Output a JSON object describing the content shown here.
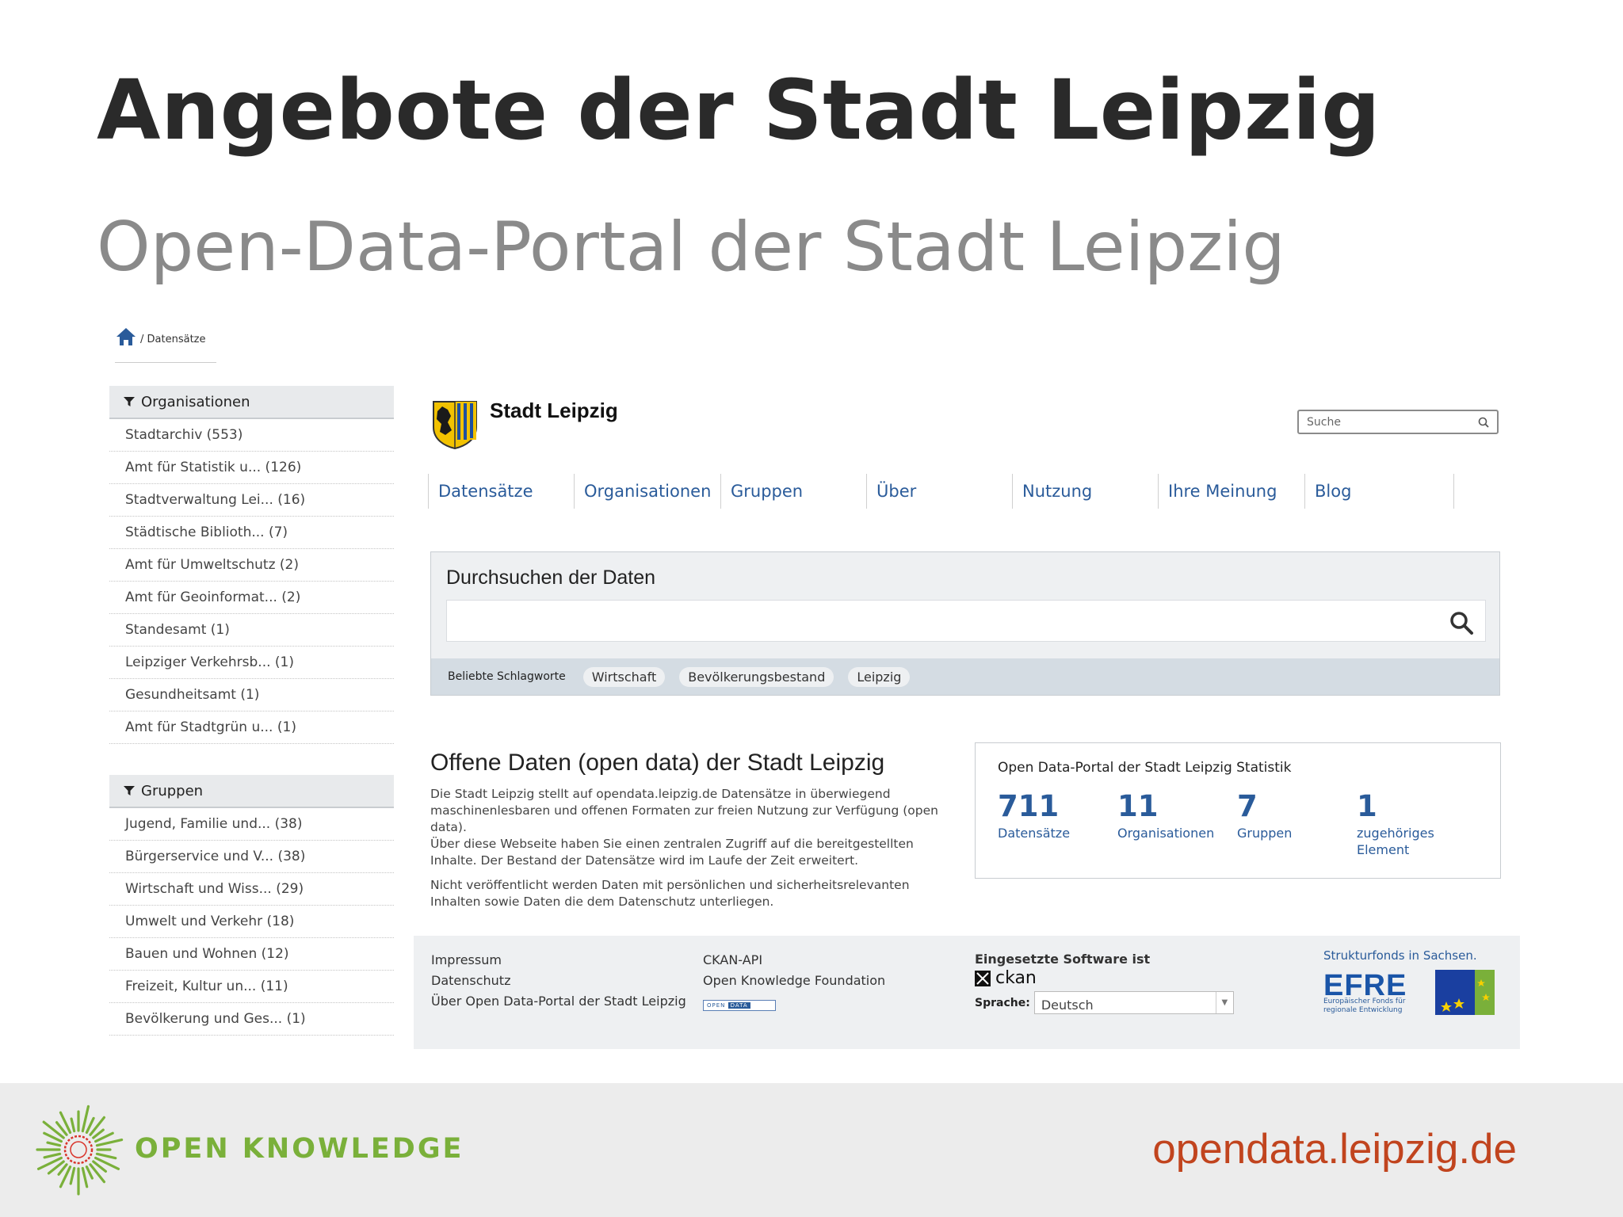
{
  "slide": {
    "title": "Angebote der Stadt Leipzig",
    "subtitle": "Open-Data-Portal der Stadt Leipzig"
  },
  "breadcrumb": {
    "icon": "home-icon",
    "current": "/ Datensätze"
  },
  "facets": {
    "organisationen": {
      "title": "Organisationen",
      "items": [
        "Stadtarchiv (553)",
        "Amt für Statistik u... (126)",
        "Stadtverwaltung Lei... (16)",
        "Städtische Biblioth... (7)",
        "Amt für Umweltschutz (2)",
        "Amt für Geoinformat... (2)",
        "Standesamt (1)",
        "Leipziger Verkehrsb... (1)",
        "Gesundheitsamt (1)",
        "Amt für Stadtgrün u... (1)"
      ]
    },
    "gruppen": {
      "title": "Gruppen",
      "items": [
        "Jugend, Familie und... (38)",
        "Bürgerservice und V... (38)",
        "Wirtschaft und Wiss... (29)",
        "Umwelt und Verkehr (18)",
        "Bauen und Wohnen (12)",
        "Freizeit, Kultur un... (11)",
        "Bevölkerung und Ges... (1)"
      ]
    }
  },
  "site": {
    "name": "Stadt Leipzig",
    "search_placeholder": "Suche",
    "nav": [
      "Datensätze",
      "Organisationen",
      "Gruppen",
      "Über",
      "Nutzung",
      "Ihre Meinung",
      "Blog"
    ]
  },
  "search_panel": {
    "title": "Durchsuchen der Daten",
    "tags_label": "Beliebte Schlagworte",
    "tags": [
      "Wirtschaft",
      "Bevölkerungsbestand",
      "Leipzig"
    ]
  },
  "intro": {
    "title": "Offene Daten (open data) der Stadt Leipzig",
    "p1": "Die Stadt Leipzig stellt auf opendata.leipzig.de Datensätze in überwiegend maschinenlesbaren und offenen Formaten zur freien Nutzung zur Verfügung (open data).",
    "p1b": "Über diese Webseite haben Sie einen zentralen Zugriff auf die bereitgestellten Inhalte. Der Bestand der Datensätze wird im Laufe der Zeit erweitert.",
    "p2": "Nicht veröffentlicht werden Daten mit persönlichen und sicherheitsrelevanten Inhalten sowie Daten die dem Datenschutz unterliegen."
  },
  "stats": {
    "title": "Open Data-Portal der Stadt Leipzig Statistik",
    "items": [
      {
        "value": "711",
        "label": "Datensätze"
      },
      {
        "value": "11",
        "label": "Organisationen"
      },
      {
        "value": "7",
        "label": "Gruppen"
      },
      {
        "value": "1",
        "label": "zugehöriges Element"
      }
    ]
  },
  "footer": {
    "col1": [
      "Impressum",
      "Datenschutz",
      "Über Open Data-Portal der Stadt Leipzig"
    ],
    "col2": [
      "CKAN-API",
      "Open Knowledge Foundation"
    ],
    "badge_left": "OPEN",
    "badge_right": "DATA",
    "software_label": "Eingesetzte Software ist",
    "software_name": "ckan",
    "language_label": "Sprache:",
    "language_value": "Deutsch",
    "efre_top": "Strukturfonds in Sachsen.",
    "efre_main": "EFRE",
    "efre_sub1": "Europäischer Fonds für",
    "efre_sub2": "regionale Entwicklung"
  },
  "bottom": {
    "org_name": "OPEN KNOWLEDGE",
    "url": "opendata.leipzig.de"
  },
  "colors": {
    "title": "#2a2a2a",
    "subtitle": "#8a8a8a",
    "link_blue": "#2a5b9a",
    "ok_green": "#7ab03a",
    "url_red": "#c1441e",
    "bottom_bar": "#ececec"
  }
}
